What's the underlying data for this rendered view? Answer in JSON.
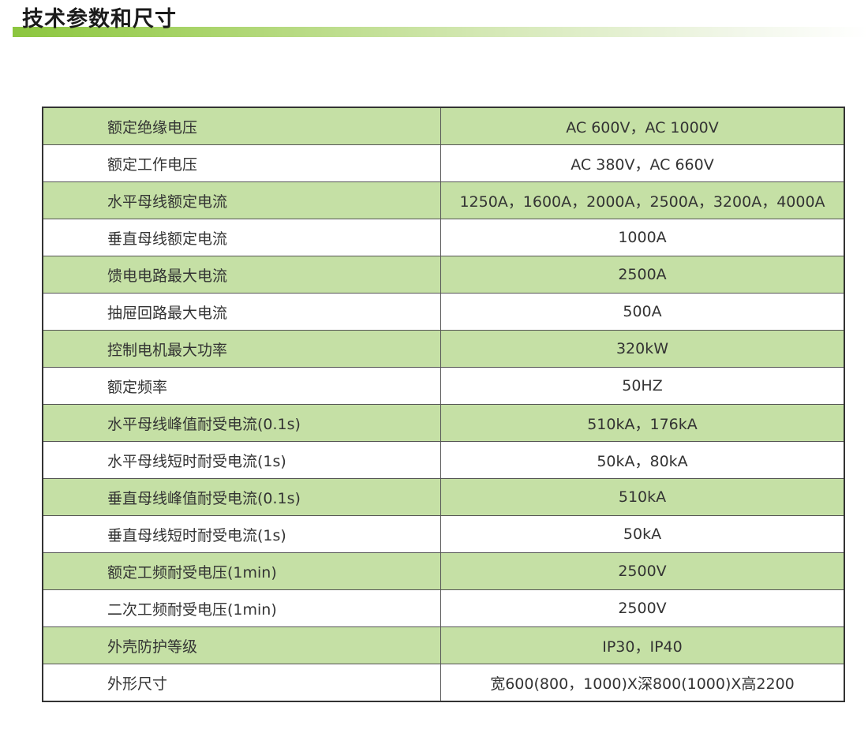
{
  "title": "技术参数和尺寸",
  "colors": {
    "accent": "#8cc63f",
    "row_shade": "#c5e0a5",
    "border": "#333333"
  },
  "specs": [
    {
      "label": "额定绝缘电压",
      "value": "AC 600V，AC 1000V"
    },
    {
      "label": "额定工作电压",
      "value": "AC 380V，AC 660V"
    },
    {
      "label": "水平母线额定电流",
      "value": "1250A，1600A，2000A，2500A，3200A，4000A"
    },
    {
      "label": "垂直母线额定电流",
      "value": "1000A"
    },
    {
      "label": "馈电电路最大电流",
      "value": "2500A"
    },
    {
      "label": "抽屉回路最大电流",
      "value": "500A"
    },
    {
      "label": "控制电机最大功率",
      "value": "320kW"
    },
    {
      "label": "额定频率",
      "value": "50HZ"
    },
    {
      "label": "水平母线峰值耐受电流(0.1s)",
      "value": "510kA，176kA"
    },
    {
      "label": "水平母线短时耐受电流(1s)",
      "value": "50kA，80kA"
    },
    {
      "label": "垂直母线峰值耐受电流(0.1s)",
      "value": "510kA"
    },
    {
      "label": "垂直母线短时耐受电流(1s)",
      "value": "50kA"
    },
    {
      "label": "额定工频耐受电压(1min)",
      "value": "2500V"
    },
    {
      "label": "二次工频耐受电压(1min)",
      "value": "2500V"
    },
    {
      "label": "外壳防护等级",
      "value": "IP30，IP40"
    },
    {
      "label": "外形尺寸",
      "value": "宽600(800，1000)X深800(1000)X高2200"
    }
  ]
}
